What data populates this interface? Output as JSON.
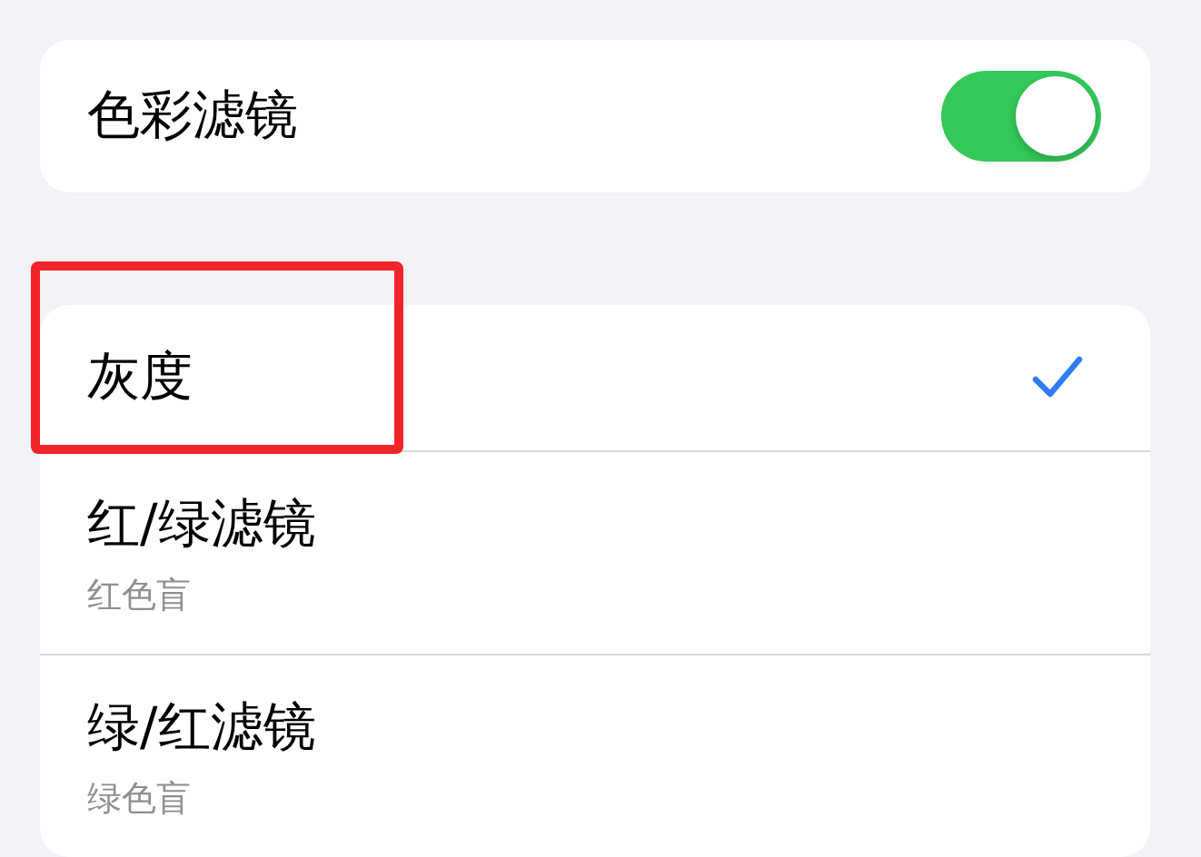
{
  "color_filters": {
    "label": "色彩滤镜",
    "on": true
  },
  "filters": [
    {
      "title": "灰度",
      "selected": true,
      "highlighted": true
    },
    {
      "title": "红/绿滤镜",
      "subtitle": "红色盲",
      "selected": false,
      "highlighted": false
    },
    {
      "title": "绿/红滤镜",
      "subtitle": "绿色盲",
      "selected": false,
      "highlighted": false
    }
  ]
}
